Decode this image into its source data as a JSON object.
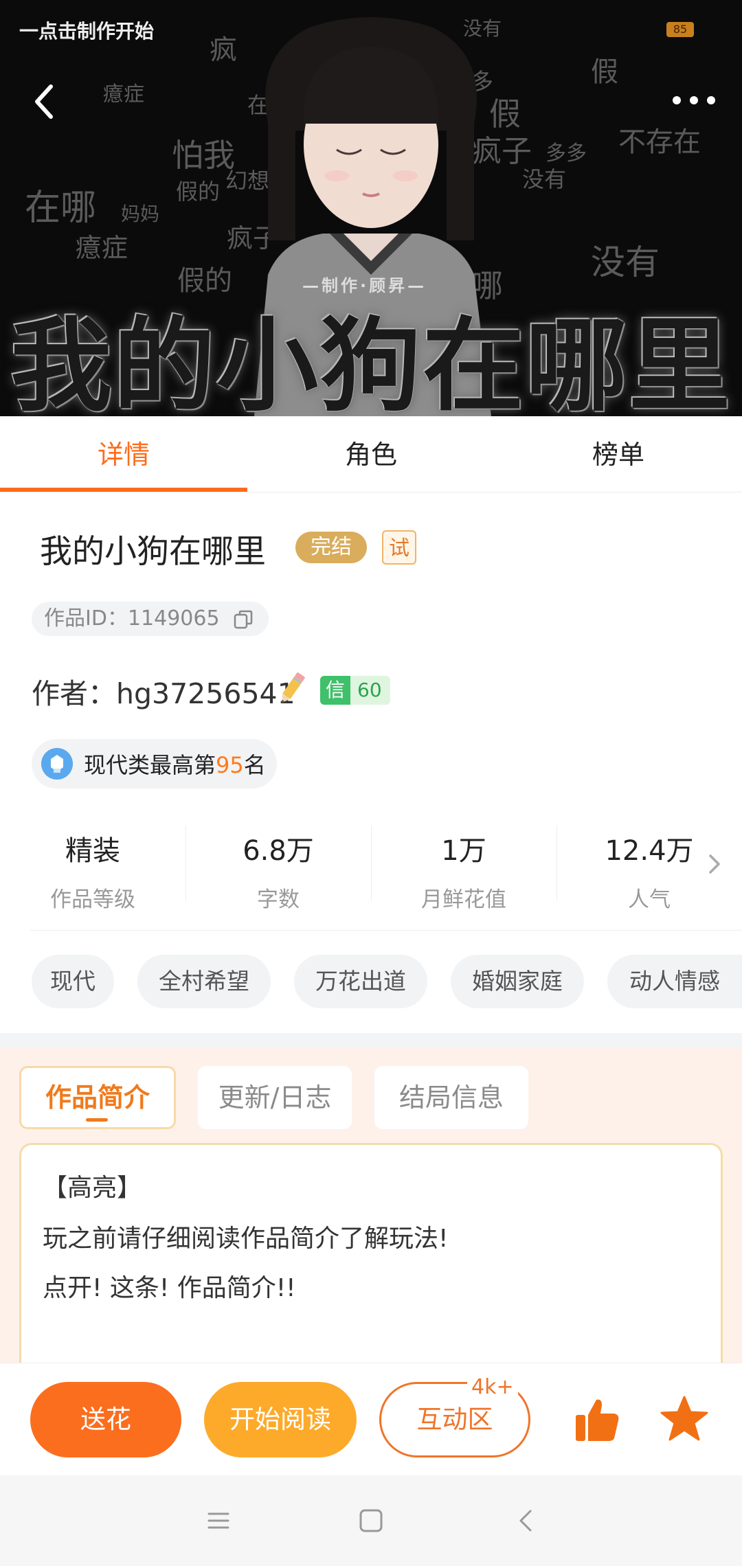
{
  "status_bar": {
    "left_text": "一点击制作开始",
    "battery": "85"
  },
  "cover": {
    "title": "我的小狗在哪里",
    "credit": "—制作·顾昇—",
    "bg_words": [
      "疯",
      "没有",
      "假",
      "癔症",
      "在哪",
      "多多",
      "假",
      "疯子",
      "不存在",
      "怕我",
      "幻想",
      "假的",
      "在哪",
      "没有",
      "多多",
      "妈妈",
      "癔症",
      "假的",
      "疯子",
      "没有",
      "在哪"
    ]
  },
  "tabs": [
    {
      "label": "详情",
      "active": true
    },
    {
      "label": "角色",
      "active": false
    },
    {
      "label": "榜单",
      "active": false
    }
  ],
  "work": {
    "title": "我的小狗在哪里",
    "status_badge": "完结",
    "trial_badge": "试",
    "id_text": "作品ID：1149065",
    "author": "作者：hg37256541",
    "credit_key": "信",
    "credit_value": "60",
    "rank_prefix": "现代类最高第",
    "rank_num": "95",
    "rank_suffix": "名"
  },
  "stats": [
    {
      "value": "精装",
      "label": "作品等级"
    },
    {
      "value": "6.8万",
      "label": "字数"
    },
    {
      "value": "1万",
      "label": "月鲜花值"
    },
    {
      "value": "12.4万",
      "label": "人气"
    }
  ],
  "tags": [
    "现代",
    "全村希望",
    "万花出道",
    "婚姻家庭",
    "动人情感"
  ],
  "intro_tabs": [
    {
      "label": "作品简介",
      "active": true
    },
    {
      "label": "更新/日志",
      "active": false
    },
    {
      "label": "结局信息",
      "active": false
    }
  ],
  "intro_lines": [
    "【高亮】",
    "玩之前请仔细阅读作品简介了解玩法!",
    "点开! 这条! 作品简介!!"
  ],
  "actions": {
    "flower": "送花",
    "read": "开始阅读",
    "chat": "互动区",
    "chat_count": "4k+"
  },
  "colors": {
    "accent": "#ff6b1a",
    "read_button": "#fdaa2a",
    "badge_done": "#d9ad5c"
  }
}
